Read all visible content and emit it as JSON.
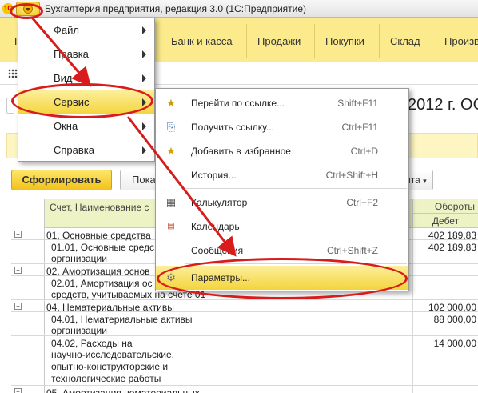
{
  "window": {
    "logo": "1С",
    "title": "Бухгалтерия предприятия, редакция 3.0  (1С:Предприятие)"
  },
  "sections": [
    {
      "label": "Г"
    },
    {
      "label": "Банк и касса"
    },
    {
      "label": "Продажи"
    },
    {
      "label": "Покупки"
    },
    {
      "label": "Склад"
    },
    {
      "label": "Произв"
    }
  ],
  "main_menu": {
    "items": [
      {
        "label": "Файл",
        "underline_index": 0
      },
      {
        "label": "Правка"
      },
      {
        "label": "Вид"
      },
      {
        "label": "Сервис",
        "highlighted": true
      },
      {
        "label": "Окна"
      },
      {
        "label": "Справка"
      }
    ]
  },
  "service_menu": {
    "items": [
      {
        "label": "Перейти по ссылке...",
        "shortcut": "Shift+F11",
        "icon": "go-to-link-icon"
      },
      {
        "label": "Получить ссылку...",
        "shortcut": "Ctrl+F11",
        "icon": "get-link-icon"
      },
      {
        "label": "Добавить в избранное",
        "shortcut": "Ctrl+D",
        "icon": "add-favorite-icon"
      },
      {
        "label": "История...",
        "shortcut": "Ctrl+Shift+H",
        "icon": ""
      },
      {
        "label": "Калькулятор",
        "shortcut": "Ctrl+F2",
        "icon": "calculator-icon"
      },
      {
        "label": "Календарь",
        "shortcut": "",
        "icon": "calendar-icon"
      },
      {
        "label": "Сообщения",
        "shortcut": "Ctrl+Shift+Z",
        "icon": ""
      },
      {
        "label": "Параметры...",
        "shortcut": "",
        "icon": "parameters-icon",
        "highlighted": true
      }
    ]
  },
  "form": {
    "title_fragment": "2012 г. ОС",
    "generate_button": "Сформировать",
    "show_button": "Пока",
    "more_button": "ита"
  },
  "report": {
    "headers": {
      "name": "Счет, Наименование с",
      "turnover": "Обороты",
      "debit": "Дебет"
    },
    "rows": [
      {
        "name": "01, Основные средства",
        "debit": "402 189,83",
        "level": 0,
        "expander": "−"
      },
      {
        "name": "01.01, Основные средс",
        "name2": "организации",
        "debit": "402 189,83",
        "level": 1
      },
      {
        "name": "02, Амортизация основ",
        "debit": "",
        "level": 0,
        "expander": "−"
      },
      {
        "name": "02.01, Амортизация ос",
        "name2": "средств, учитываемых на счете 01",
        "debit": "",
        "level": 1
      },
      {
        "name": "04, Нематериальные активы",
        "debit": "102 000,00",
        "level": 0,
        "expander": "−"
      },
      {
        "name": "04.01, Нематериальные активы",
        "name2": "организации",
        "debit": "88 000,00",
        "level": 1
      },
      {
        "name": "04.02, Расходы на",
        "name2": "научно-исследовательские,",
        "name3": "опытно-конструкторские и",
        "name4": "технологические работы",
        "debit": "14 000,00",
        "level": 1
      },
      {
        "name": "05, Амортизация нематериальных",
        "debit": "",
        "level": 0,
        "expander": "−"
      }
    ]
  },
  "colors": {
    "accent_yellow": "#f4d43c",
    "section_bar": "#fbeb8d",
    "annotation_red": "#d81b1b"
  }
}
